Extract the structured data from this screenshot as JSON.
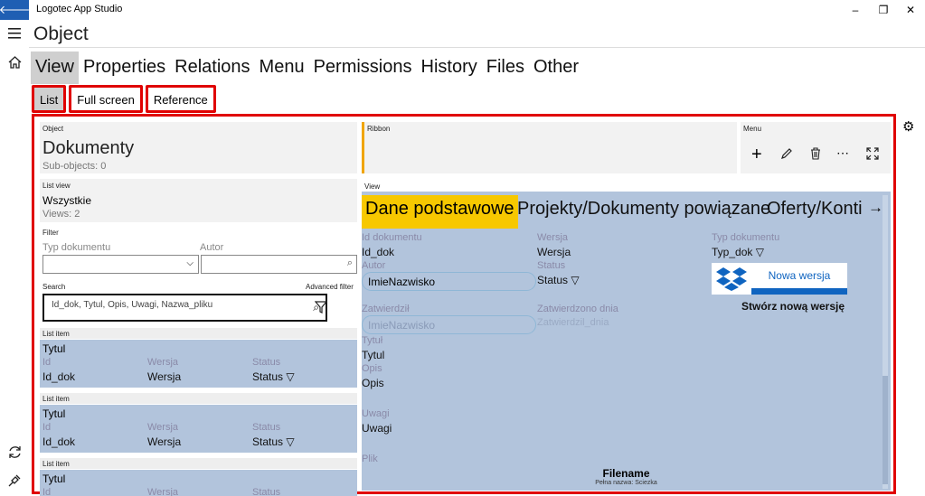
{
  "app": {
    "title": "Logotec App Studio"
  },
  "window": {
    "minimize": "–",
    "maximize": "❐",
    "close": "✕"
  },
  "page": {
    "title": "Object"
  },
  "main_tabs": [
    {
      "label": "View"
    },
    {
      "label": "Properties"
    },
    {
      "label": "Relations"
    },
    {
      "label": "Menu"
    },
    {
      "label": "Permissions"
    },
    {
      "label": "History"
    },
    {
      "label": "Files"
    },
    {
      "label": "Other"
    }
  ],
  "sub_tabs": [
    {
      "label": "List"
    },
    {
      "label": "Full screen"
    },
    {
      "label": "Reference"
    }
  ],
  "object": {
    "section": "Object",
    "name": "Dokumenty",
    "sub": "Sub-objects: 0"
  },
  "ribbon": {
    "section": "Ribbon"
  },
  "menu": {
    "section": "Menu",
    "icons": [
      "add-icon",
      "edit-icon",
      "delete-icon",
      "more-icon",
      "expand-icon"
    ]
  },
  "list_view": {
    "section": "List view",
    "name": "Wszystkie",
    "count": "Views: 2"
  },
  "filter": {
    "section": "Filter",
    "field1": "Typ dokumentu",
    "field2": "Autor"
  },
  "search": {
    "section": "Search",
    "value": "Id_dok, Tytul, Opis, Uwagi, Nazwa_pliku",
    "advanced": "Advanced filter"
  },
  "list_items": [
    {
      "section": "List item",
      "title": "Tytul",
      "c1_label": "Id",
      "c2_label": "Wersja",
      "c3_label": "Status",
      "c1_val": "Id_dok",
      "c2_val": "Wersja",
      "c3_val": "Status ▽"
    },
    {
      "section": "List item",
      "title": "Tytul",
      "c1_label": "Id",
      "c2_label": "Wersja",
      "c3_label": "Status",
      "c1_val": "Id_dok",
      "c2_val": "Wersja",
      "c3_val": "Status ▽"
    },
    {
      "section": "List item",
      "title": "Tytul",
      "c1_label": "Id",
      "c2_label": "Wersja",
      "c3_label": "Status"
    }
  ],
  "view": {
    "section": "View",
    "tabs": [
      {
        "label": "Dane podstawowe"
      },
      {
        "label": "Projekty/Dokumenty powiązane"
      },
      {
        "label": "Oferty/Konti"
      }
    ],
    "next_arrow": "→",
    "fields": {
      "id_label": "Id dokumentu",
      "id_val": "Id_dok",
      "wersja_label": "Wersja",
      "wersja_val": "Wersja",
      "typ_label": "Typ dokumentu",
      "typ_val": "Typ_dok ▽",
      "autor_label": "Autor",
      "autor_val": "ImieNazwisko",
      "status_label": "Status",
      "status_val": "Status ▽",
      "zatw_label": "Zatwierdził",
      "zatw_val": "ImieNazwisko",
      "zatw_dnia_label": "Zatwierdzono dnia",
      "zatw_dnia_val": "Zatwierdzil_dnia",
      "tytul_label": "Tytuł",
      "tytul_val": "Tytul",
      "opis_label": "Opis",
      "opis_val": "Opis",
      "uwagi_label": "Uwagi",
      "uwagi_val": "Uwagi",
      "plik_label": "Plik",
      "filename": "Filename",
      "fullpath": "Pełna nazwa: Sciezka"
    },
    "new_version": {
      "button": "Nowa wersja",
      "caption": "Stwórz nową wersję"
    }
  },
  "colors": {
    "accent_red": "#e00000",
    "view_bg": "#b2c4dc",
    "tab_active": "#f7c800",
    "titlebar_back": "#1f5fb3",
    "ribbon_accent": "#f0a500",
    "dropbox_blue": "#0f64c0"
  }
}
